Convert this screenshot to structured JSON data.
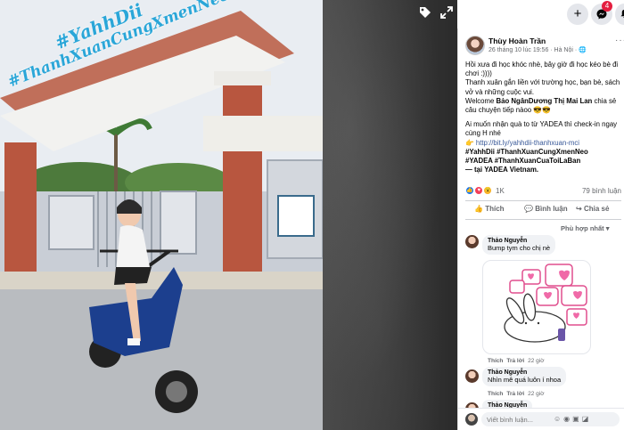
{
  "photo": {
    "hashtag_top": "#YahhDii",
    "hashtag_bottom": "#ThanhXuanCungXmenNeo"
  },
  "topbar": {
    "notification_badge": "4"
  },
  "post": {
    "author": "Thùy Hoàn Trần",
    "meta": "26 tháng 10 lúc 19:56 · Hà Nội ·",
    "more": "···",
    "line1": "Hồi xưa đi học khóc nhè, bây giờ đi học kéo bè đi chơi :))))",
    "line2": "Thanh xuân gắn liền với trường học, bạn bè, sách vở và những cuộc vui.",
    "welcome_prefix": "Welcome",
    "tagged": "Bảo NgânDương Thị Mai Lan",
    "welcome_suffix": "chia sẻ câu chuyện tiếp nàoo 😎😎",
    "line4": "Ai muốn nhận quà to từ YADEA thì check-in ngay cùng H nhé",
    "link_prefix": "👉",
    "link": "http://bit.ly/yahhdii-thanhxuan-mci",
    "hashtags1": "#YahhDii #ThanhXuanCungXmenNeo",
    "hashtags2": "#YADEA #ThanhXuanCuaToiLaBan",
    "location_prefix": "— tại",
    "location": "YADEA Vietnam."
  },
  "stats": {
    "reaction_count": "1K",
    "comment_count": "79 bình luận"
  },
  "actions": {
    "like": "Thích",
    "comment": "Bình luận",
    "share": "Chia sẻ"
  },
  "sort_label": "Phù hợp nhất ▾",
  "comments": [
    {
      "name": "Thảo Nguyễn",
      "text": "Bump tym cho chị nè",
      "like": "Thích",
      "reply": "Trả lời",
      "time": "22 giờ"
    },
    {
      "name": "Thảo Nguyễn",
      "text": "Nhìn mê quá luôn í nhoa",
      "like": "Thích",
      "reply": "Trả lời",
      "time": "22 giờ"
    },
    {
      "name": "Thảo Nguyễn",
      "text": ""
    }
  ],
  "composer": {
    "placeholder": "Viết bình luận..."
  },
  "icons": {
    "tag": "tag-icon",
    "fullscreen": "fullscreen-icon",
    "plus": "plus-icon",
    "messenger": "messenger-icon",
    "notifications": "bell-icon"
  },
  "colors": {
    "hashtag": "#2aa6d8",
    "link": "#385898",
    "badge": "#e41e3f",
    "like": "#1877f2"
  }
}
